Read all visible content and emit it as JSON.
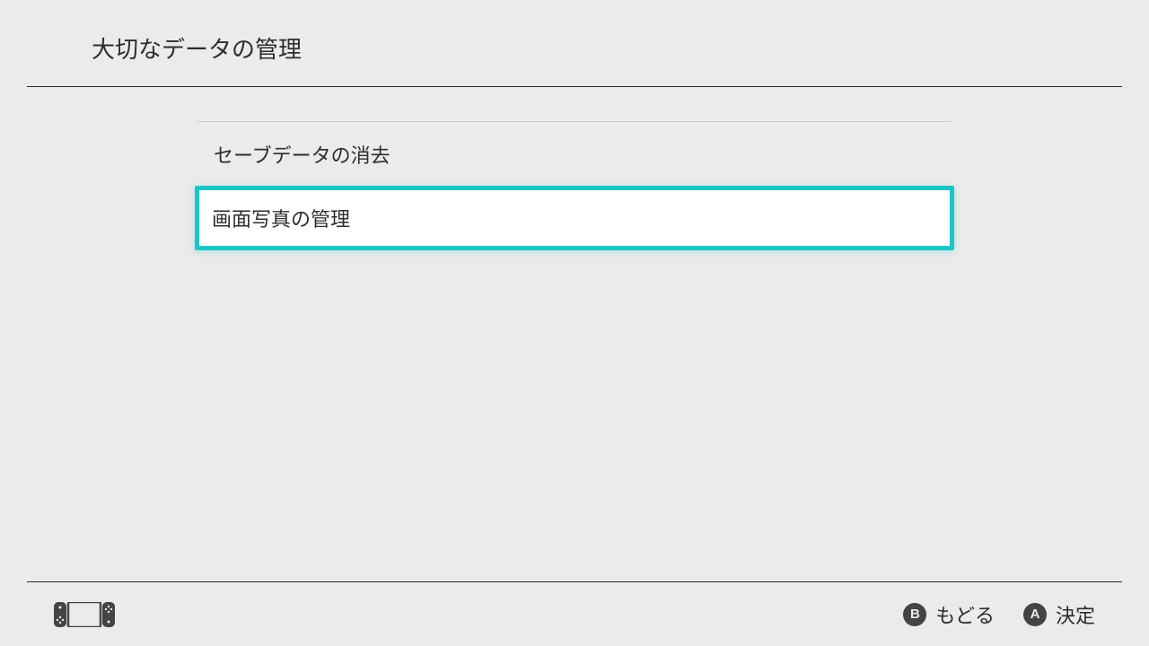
{
  "header": {
    "title": "大切なデータの管理"
  },
  "menu": {
    "items": [
      {
        "label": "セーブデータの消去",
        "selected": false
      },
      {
        "label": "画面写真の管理",
        "selected": true
      }
    ]
  },
  "footer": {
    "buttons": [
      {
        "key": "B",
        "label": "もどる"
      },
      {
        "key": "A",
        "label": "決定"
      }
    ]
  }
}
